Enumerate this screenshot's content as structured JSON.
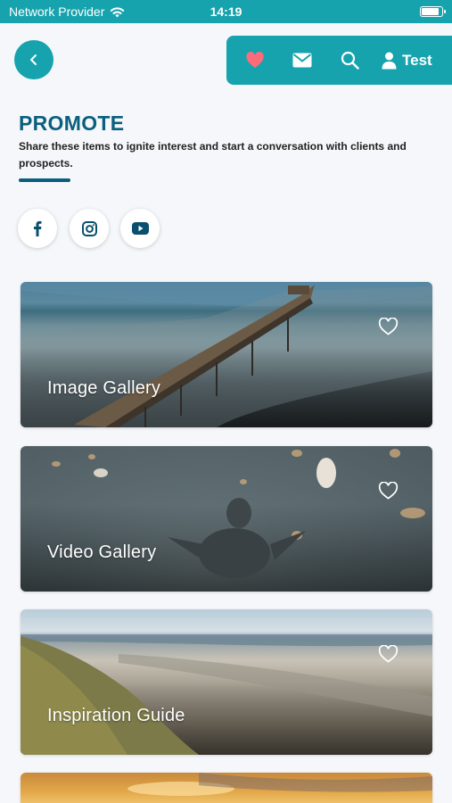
{
  "status_bar": {
    "carrier": "Network Provider",
    "time": "14:19"
  },
  "topbar": {
    "user_label": "Test",
    "icons": [
      "heart-icon",
      "mail-icon",
      "search-icon",
      "user-icon"
    ]
  },
  "colors": {
    "accent": "#16a3ad",
    "title": "#0a5f7e",
    "favorite": "#ff6b7a"
  },
  "section": {
    "title": "PROMOTE",
    "description": "Share these items to ignite interest and start a conversation with clients and prospects."
  },
  "social": [
    "facebook-icon",
    "instagram-icon",
    "youtube-icon"
  ],
  "cards": [
    {
      "label": "Image Gallery"
    },
    {
      "label": "Video Gallery"
    },
    {
      "label": "Inspiration Guide"
    },
    {
      "label": ""
    }
  ]
}
